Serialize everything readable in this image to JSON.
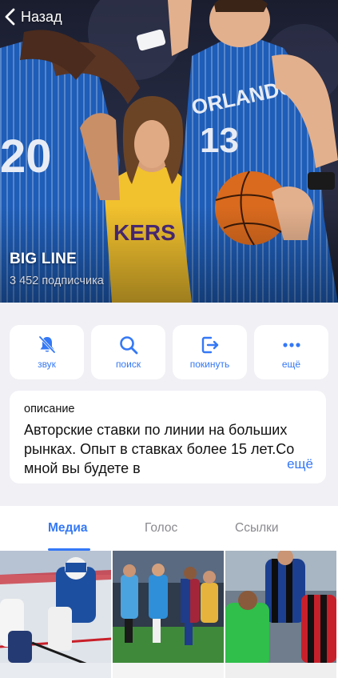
{
  "nav": {
    "back_label": "Назад"
  },
  "channel": {
    "title": "BIG LINE",
    "subscribers": "3 452 подписчика"
  },
  "actions": [
    {
      "label": "звук",
      "icon": "bell-muted-icon"
    },
    {
      "label": "поиск",
      "icon": "search-icon"
    },
    {
      "label": "покинуть",
      "icon": "leave-icon"
    },
    {
      "label": "ещё",
      "icon": "more-dots-icon"
    }
  ],
  "description": {
    "label": "описание",
    "text": "Авторские ставки по линии на больших рынках. Опыт в ставках более 15 лет.Со мной вы будете в",
    "more_label": "ещё"
  },
  "tabs": [
    {
      "label": "Медиа",
      "active": true
    },
    {
      "label": "Голос",
      "active": false
    },
    {
      "label": "Ссылки",
      "active": false
    }
  ],
  "colors": {
    "accent": "#3478f6",
    "background": "#f0f0f5"
  }
}
